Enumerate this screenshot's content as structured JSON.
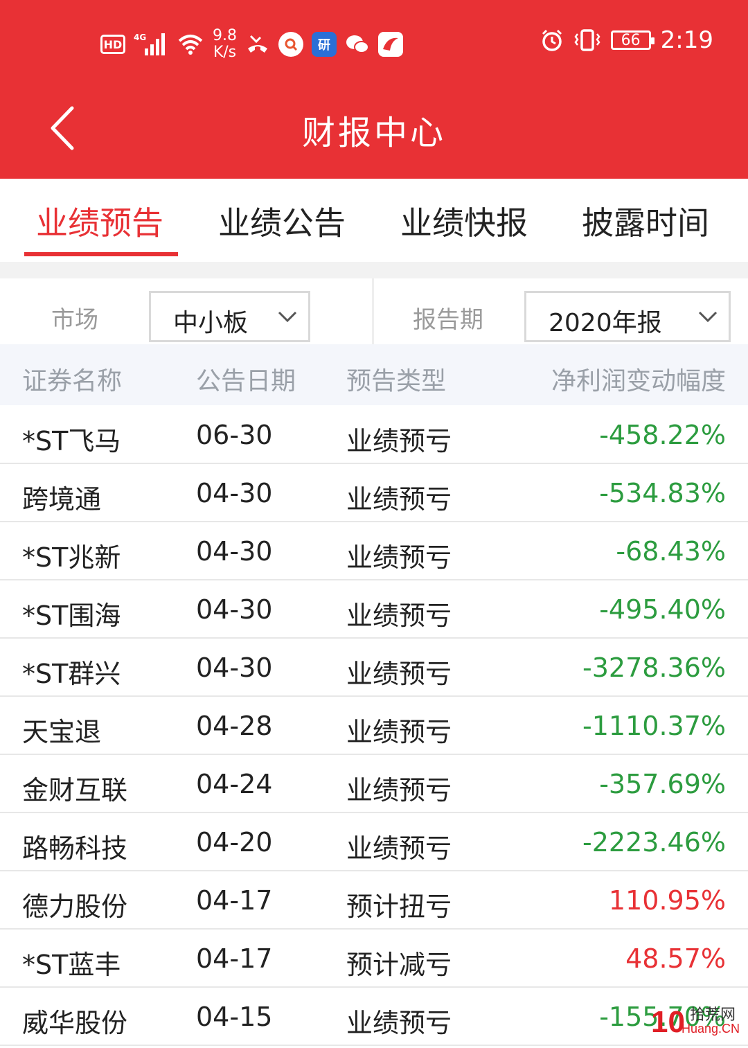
{
  "status_bar": {
    "hd": "HD",
    "network": "4G",
    "speed_value": "9.8",
    "speed_unit": "K/s",
    "icons": [
      "hd-icon",
      "signal-icon",
      "wifi-icon",
      "missed-call-icon",
      "search-app-icon",
      "yan-app-icon",
      "wechat-icon",
      "news-app-icon",
      "alarm-icon",
      "vibrate-icon",
      "battery-icon"
    ],
    "app_yan": "研",
    "battery": "66",
    "time": "2:19"
  },
  "header": {
    "title": "财报中心"
  },
  "tabs": [
    {
      "label": "业绩预告",
      "active": true
    },
    {
      "label": "业绩公告",
      "active": false
    },
    {
      "label": "业绩快报",
      "active": false
    },
    {
      "label": "披露时间",
      "active": false
    }
  ],
  "filters": {
    "market_label": "市场",
    "market_value": "中小板",
    "period_label": "报告期",
    "period_value": "2020年报"
  },
  "table": {
    "columns": [
      "证券名称",
      "公告日期",
      "预告类型",
      "净利润变动幅度"
    ],
    "rows": [
      {
        "name": "*ST飞马",
        "date": "06-30",
        "type": "业绩预亏",
        "change": "-458.22%"
      },
      {
        "name": "跨境通",
        "date": "04-30",
        "type": "业绩预亏",
        "change": "-534.83%"
      },
      {
        "name": "*ST兆新",
        "date": "04-30",
        "type": "业绩预亏",
        "change": "-68.43%"
      },
      {
        "name": "*ST围海",
        "date": "04-30",
        "type": "业绩预亏",
        "change": "-495.40%"
      },
      {
        "name": "*ST群兴",
        "date": "04-30",
        "type": "业绩预亏",
        "change": "-3278.36%"
      },
      {
        "name": "天宝退",
        "date": "04-28",
        "type": "业绩预亏",
        "change": "-1110.37%"
      },
      {
        "name": "金财互联",
        "date": "04-24",
        "type": "业绩预亏",
        "change": "-357.69%"
      },
      {
        "name": "路畅科技",
        "date": "04-20",
        "type": "业绩预亏",
        "change": "-2223.46%"
      },
      {
        "name": "德力股份",
        "date": "04-17",
        "type": "预计扭亏",
        "change": "110.95%"
      },
      {
        "name": "*ST蓝丰",
        "date": "04-17",
        "type": "预计减亏",
        "change": "48.57%"
      },
      {
        "name": "威华股份",
        "date": "04-15",
        "type": "业绩预亏",
        "change": "-155.70%"
      }
    ]
  },
  "watermark": {
    "number": "10",
    "cn": "拾荒网",
    "en": "Huang.CN"
  },
  "colors": {
    "brand_red": "#e83135",
    "loss_green": "#2c9c3f",
    "gain_red": "#e83135"
  }
}
